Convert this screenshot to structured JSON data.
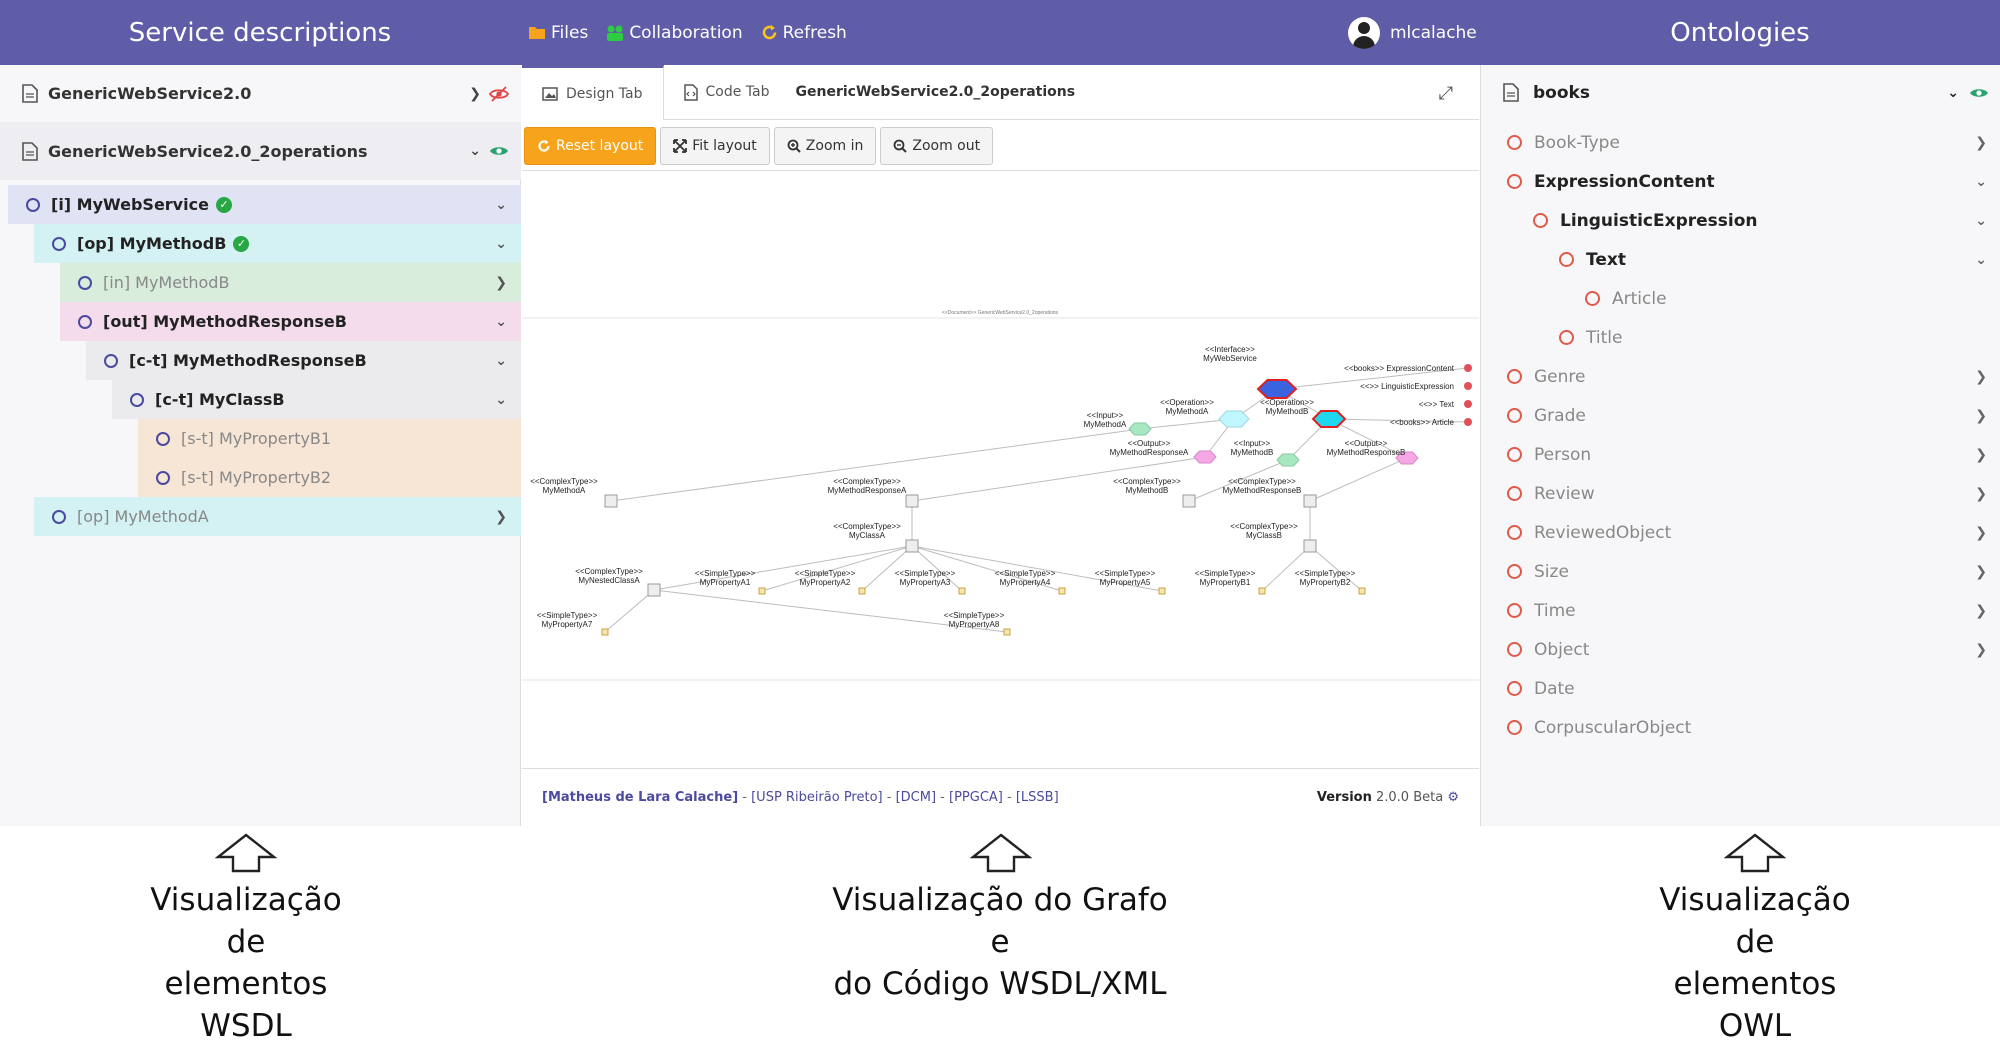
{
  "topbar": {
    "left_title": "Service descriptions",
    "right_title": "Ontologies",
    "nav": [
      {
        "label": "Files",
        "icon": "folder-icon",
        "color": "#f7a31c"
      },
      {
        "label": "Collaboration",
        "icon": "users-icon",
        "color": "#2ecc40"
      },
      {
        "label": "Refresh",
        "icon": "refresh-icon",
        "color": "#f7c31c"
      }
    ],
    "username": "mlcalache"
  },
  "left_panel": {
    "services": [
      {
        "name": "GenericWebService2.0",
        "visible": false
      },
      {
        "name": "GenericWebService2.0_2operations",
        "visible": true
      }
    ],
    "tree": [
      {
        "label": "[i] MyWebService",
        "verified": true
      },
      {
        "label": "[op] MyMethodB",
        "verified": true
      },
      {
        "label": "[in] MyMethodB"
      },
      {
        "label": "[out] MyMethodResponseB"
      },
      {
        "label": "[c-t] MyMethodResponseB"
      },
      {
        "label": "[c-t] MyClassB"
      },
      {
        "label": "[s-t] MyPropertyB1"
      },
      {
        "label": "[s-t] MyPropertyB2"
      },
      {
        "label": "[op] MyMethodA"
      }
    ]
  },
  "center": {
    "tabs": [
      {
        "label": "Design Tab"
      },
      {
        "label": "Code Tab"
      }
    ],
    "doc_title": "GenericWebService2.0_2operations",
    "toolbar": {
      "reset": "Reset layout",
      "fit": "Fit layout",
      "zoom_in": "Zoom in",
      "zoom_out": "Zoom out"
    },
    "graph": {
      "document_label": "<<Document>> GenericWebService2.0_2operations",
      "nodes": [
        {
          "id": "iface",
          "stereo": "<<Interface>>",
          "name": "MyWebService",
          "kind": "interface"
        },
        {
          "id": "opA",
          "stereo": "<<Operation>>",
          "name": "MyMethodA",
          "kind": "operation"
        },
        {
          "id": "opB",
          "stereo": "<<Operation>>",
          "name": "MyMethodB",
          "kind": "operation-selected"
        },
        {
          "id": "inA",
          "stereo": "<<Input>>",
          "name": "MyMethodA",
          "kind": "input"
        },
        {
          "id": "outA",
          "stereo": "<<Output>>",
          "name": "MyMethodResponseA",
          "kind": "output"
        },
        {
          "id": "inB",
          "stereo": "<<Input>>",
          "name": "MyMethodB",
          "kind": "input"
        },
        {
          "id": "outB",
          "stereo": "<<Output>>",
          "name": "MyMethodResponseB",
          "kind": "output"
        },
        {
          "id": "ctA",
          "stereo": "<<ComplexType>>",
          "name": "MyMethodA",
          "kind": "complex"
        },
        {
          "id": "ctRA",
          "stereo": "<<ComplexType>>",
          "name": "MyMethodResponseA",
          "kind": "complex"
        },
        {
          "id": "ctB",
          "stereo": "<<ComplexType>>",
          "name": "MyMethodB",
          "kind": "complex"
        },
        {
          "id": "ctRB",
          "stereo": "<<ComplexType>>",
          "name": "MyMethodResponseB",
          "kind": "complex"
        },
        {
          "id": "ctClassA",
          "stereo": "<<ComplexType>>",
          "name": "MyClassA",
          "kind": "complex"
        },
        {
          "id": "ctClassB",
          "stereo": "<<ComplexType>>",
          "name": "MyClassB",
          "kind": "complex"
        },
        {
          "id": "ctNested",
          "stereo": "<<ComplexType>>",
          "name": "MyNestedClassA",
          "kind": "complex"
        },
        {
          "id": "pA1",
          "stereo": "<<SimpleType>>",
          "name": "MyPropertyA1",
          "kind": "simple"
        },
        {
          "id": "pA2",
          "stereo": "<<SimpleType>>",
          "name": "MyPropertyA2",
          "kind": "simple"
        },
        {
          "id": "pA3",
          "stereo": "<<SimpleType>>",
          "name": "MyPropertyA3",
          "kind": "simple"
        },
        {
          "id": "pA4",
          "stereo": "<<SimpleType>>",
          "name": "MyPropertyA4",
          "kind": "simple"
        },
        {
          "id": "pA5",
          "stereo": "<<SimpleType>>",
          "name": "MyPropertyA5",
          "kind": "simple"
        },
        {
          "id": "pA7",
          "stereo": "<<SimpleType>>",
          "name": "MyPropertyA7",
          "kind": "simple"
        },
        {
          "id": "pA8",
          "stereo": "<<SimpleType>>",
          "name": "MyPropertyA8",
          "kind": "simple"
        },
        {
          "id": "pB1",
          "stereo": "<<SimpleType>>",
          "name": "MyPropertyB1",
          "kind": "simple"
        },
        {
          "id": "pB2",
          "stereo": "<<SimpleType>>",
          "name": "MyPropertyB2",
          "kind": "simple"
        },
        {
          "id": "oExpr",
          "stereo": "",
          "name": "<<books>> ExpressionContent",
          "kind": "ontology"
        },
        {
          "id": "oLing",
          "stereo": "",
          "name": "<<>> LinguisticExpression",
          "kind": "ontology"
        },
        {
          "id": "oText",
          "stereo": "",
          "name": "<<>> Text",
          "kind": "ontology"
        },
        {
          "id": "oArt",
          "stereo": "",
          "name": "<<books>> Article",
          "kind": "ontology"
        }
      ]
    },
    "footer": {
      "author": "[Matheus de Lara Calache]",
      "links": [
        "[USP Ribeirão Preto]",
        "[DCM]",
        "[PPGCA]",
        "[LSSB]"
      ],
      "version_label": "Version",
      "version": "2.0.0 Beta"
    }
  },
  "right_panel": {
    "ontology": "books",
    "classes": [
      {
        "label": "Book-Type"
      },
      {
        "label": "ExpressionContent"
      },
      {
        "label": "LinguisticExpression"
      },
      {
        "label": "Text"
      },
      {
        "label": "Article"
      },
      {
        "label": "Title"
      },
      {
        "label": "Genre"
      },
      {
        "label": "Grade"
      },
      {
        "label": "Person"
      },
      {
        "label": "Review"
      },
      {
        "label": "ReviewedObject"
      },
      {
        "label": "Size"
      },
      {
        "label": "Time"
      },
      {
        "label": "Object"
      },
      {
        "label": "Date"
      },
      {
        "label": "CorpuscularObject"
      }
    ]
  },
  "captions": {
    "left": [
      "Visualização",
      "de",
      "elementos",
      "WSDL"
    ],
    "center": [
      "Visualização do Grafo",
      "e",
      "do Código WSDL/XML"
    ],
    "right": [
      "Visualização",
      "de",
      "elementos",
      "OWL"
    ]
  }
}
